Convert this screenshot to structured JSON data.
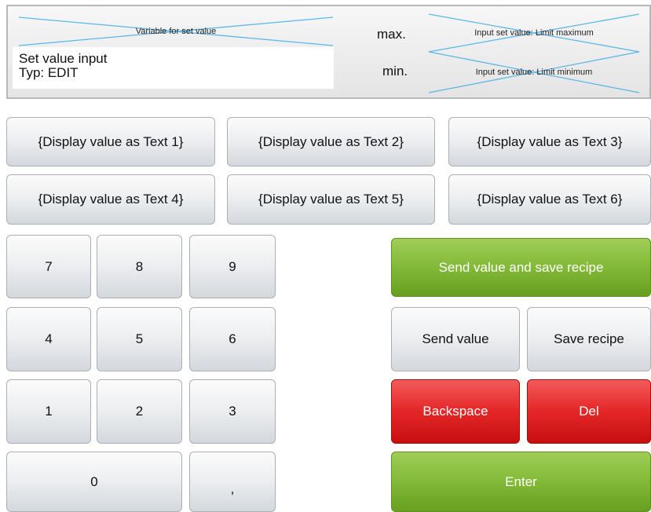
{
  "header": {
    "variable_label": "Variable for set value",
    "input_line1": "Set value input",
    "input_line2": "Typ: EDIT",
    "max_label": "max.",
    "min_label": "min.",
    "limit_max_label": "Input set value: Limit maximum",
    "limit_min_label": "Input set value: Limit minimum",
    "cross_color": "#5bb8e8"
  },
  "text_buttons": [
    "{Display value as Text 1}",
    "{Display value as Text 2}",
    "{Display value as Text 3}",
    "{Display value as Text 4}",
    "{Display value as Text 5}",
    "{Display value as Text 6}"
  ],
  "keypad": {
    "k7": "7",
    "k8": "8",
    "k9": "9",
    "k4": "4",
    "k5": "5",
    "k6": "6",
    "k1": "1",
    "k2": "2",
    "k3": "3",
    "k0": "0",
    "comma": ","
  },
  "actions": {
    "send_and_save": "Send value and save recipe",
    "send_value": "Send value",
    "save_recipe": "Save recipe",
    "backspace": "Backspace",
    "del": "Del",
    "enter": "Enter"
  },
  "colors": {
    "green": "#86bb3a",
    "red": "#e42626",
    "panel_border": "#b8b8b8"
  }
}
